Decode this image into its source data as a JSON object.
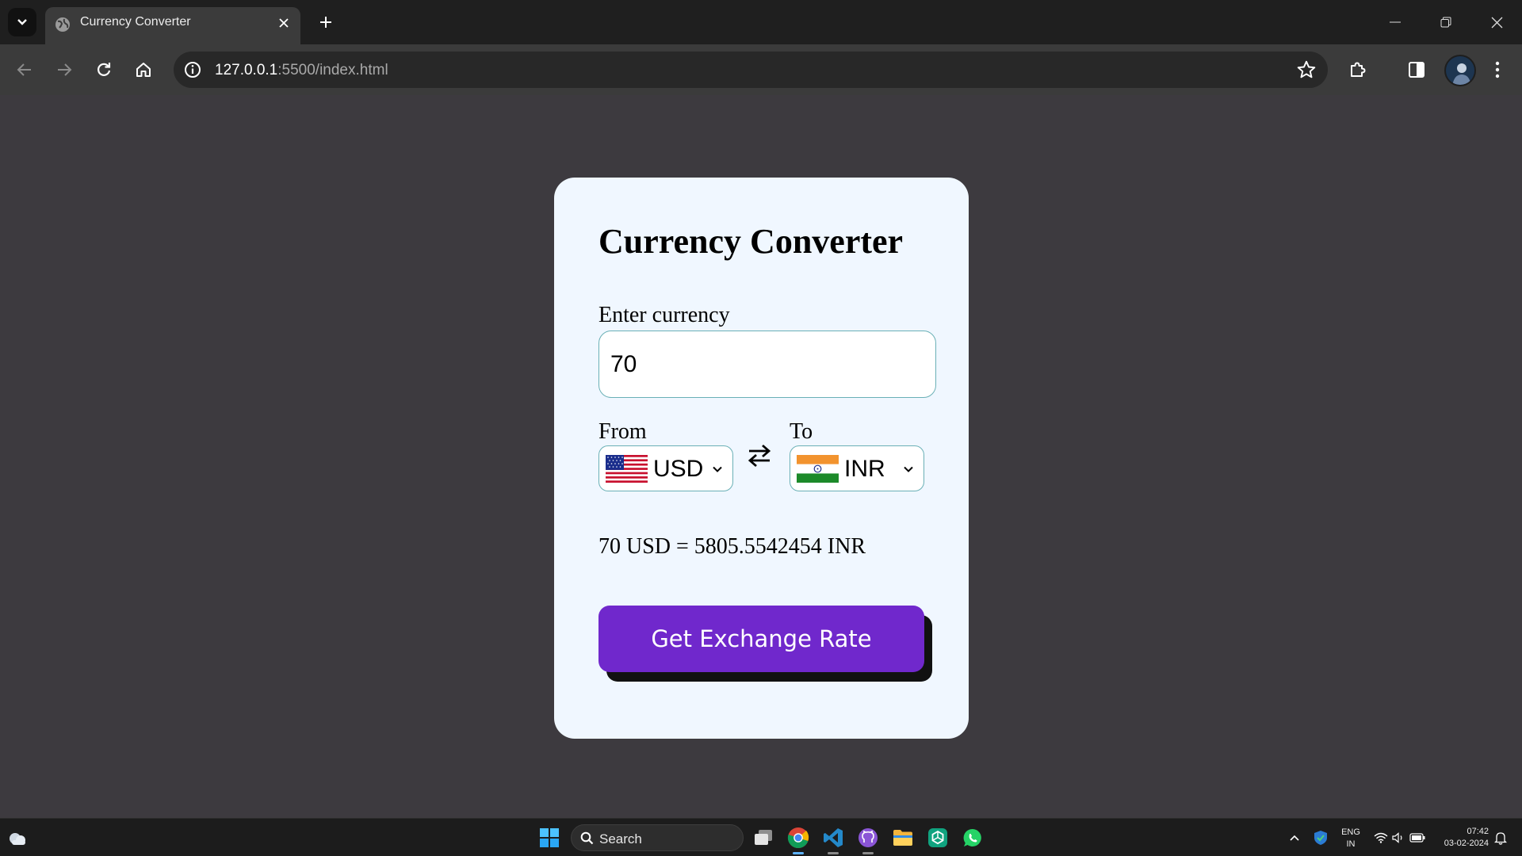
{
  "browser": {
    "tab_title": "Currency Converter",
    "url_host": "127.0.0.1",
    "url_path": ":5500/index.html"
  },
  "converter": {
    "title": "Currency Converter",
    "amount_label": "Enter currency",
    "amount_value": "70",
    "from_label": "From",
    "from_currency": "USD",
    "to_label": "To",
    "to_currency": "INR",
    "result_text": "70 USD = 5805.5542454 INR",
    "button_label": "Get Exchange Rate"
  },
  "taskbar": {
    "search_placeholder": "Search",
    "lang_line1": "ENG",
    "lang_line2": "IN",
    "time": "07:42",
    "date": "03-02-2024"
  },
  "colors": {
    "page_background": "#3d3a3f",
    "card_background": "#f0f7ff",
    "button": "#7028cc",
    "input_border": "#6ab0b6"
  },
  "icons": {
    "tabbar": [
      "tab-search-chevron-icon",
      "globe-icon",
      "close-icon",
      "plus-icon",
      "minimize-icon",
      "restore-icon",
      "close-window-icon"
    ],
    "toolbar": [
      "back-arrow-icon",
      "forward-arrow-icon",
      "reload-icon",
      "home-icon",
      "site-info-icon",
      "star-icon",
      "extensions-icon",
      "side-panel-icon",
      "menu-dots-icon"
    ],
    "page": [
      "us-flag-icon",
      "india-flag-icon",
      "swap-arrows-icon",
      "chevron-down-icon"
    ],
    "taskbar": [
      "weather-icon",
      "windows-start-icon",
      "search-icon",
      "task-view-icon",
      "chrome-icon",
      "vscode-icon",
      "github-icon",
      "file-explorer-icon",
      "chatgpt-icon",
      "whatsapp-icon",
      "tray-chevron-icon",
      "defender-icon",
      "wifi-icon",
      "volume-icon",
      "battery-icon",
      "notification-bell-icon"
    ]
  }
}
